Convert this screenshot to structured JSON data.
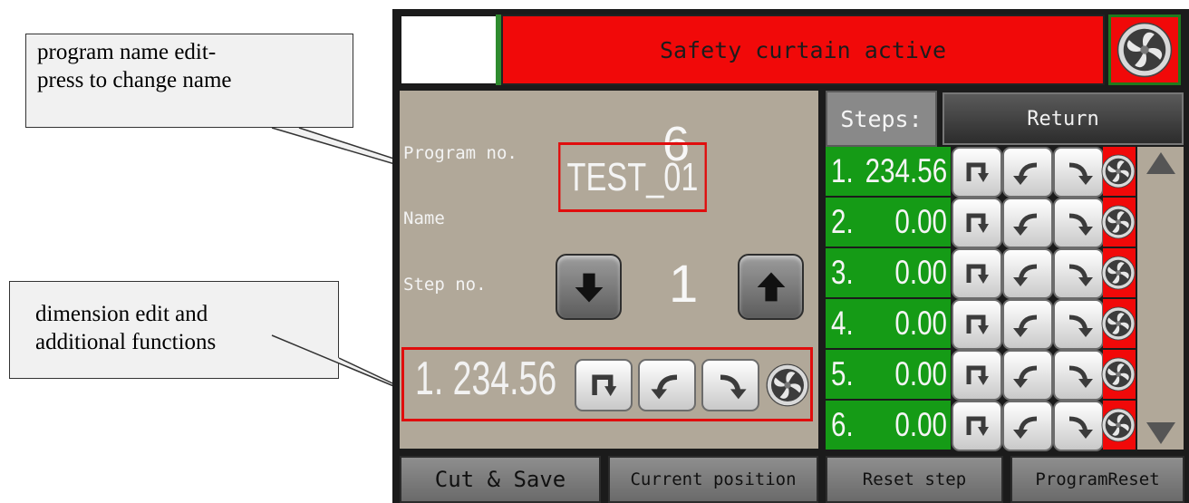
{
  "callouts": {
    "program_name": "program name edit-press to change name",
    "program_name_line1": "program name edit-",
    "program_name_line2": "press to change name",
    "dimension_line1": "dimension edit and",
    "dimension_line2": "additional functions"
  },
  "header": {
    "banner_text": "Safety curtain active",
    "banner_color": "#f10909"
  },
  "program": {
    "program_no_label": "Program no.",
    "program_no": "6",
    "name_label": "Name",
    "name": "TEST_01",
    "step_no_label": "Step no.",
    "step_no": "1"
  },
  "current_step": {
    "index": "1.",
    "value": "234.56"
  },
  "steps_panel": {
    "label": "Steps:",
    "return_label": "Return",
    "rows": [
      {
        "index": "1.",
        "value": "234.56"
      },
      {
        "index": "2.",
        "value": "0.00"
      },
      {
        "index": "3.",
        "value": "0.00"
      },
      {
        "index": "4.",
        "value": "0.00"
      },
      {
        "index": "5.",
        "value": "0.00"
      },
      {
        "index": "6.",
        "value": "0.00"
      }
    ]
  },
  "bottom_bar": {
    "cut_save": "Cut & Save",
    "current_position": "Current position",
    "reset_step": "Reset step",
    "program_reset": "ProgramReset"
  },
  "icons": {
    "fan": "fan-icon",
    "down_arrow": "arrow-down-icon",
    "up_arrow": "arrow-up-icon",
    "bend_down": "bend-down-icon",
    "curve_left": "curve-left-icon",
    "curve_right": "curve-right-icon"
  },
  "colors": {
    "panel": "#b1a899",
    "step_green": "#159b16",
    "alert_red": "#f10909"
  }
}
